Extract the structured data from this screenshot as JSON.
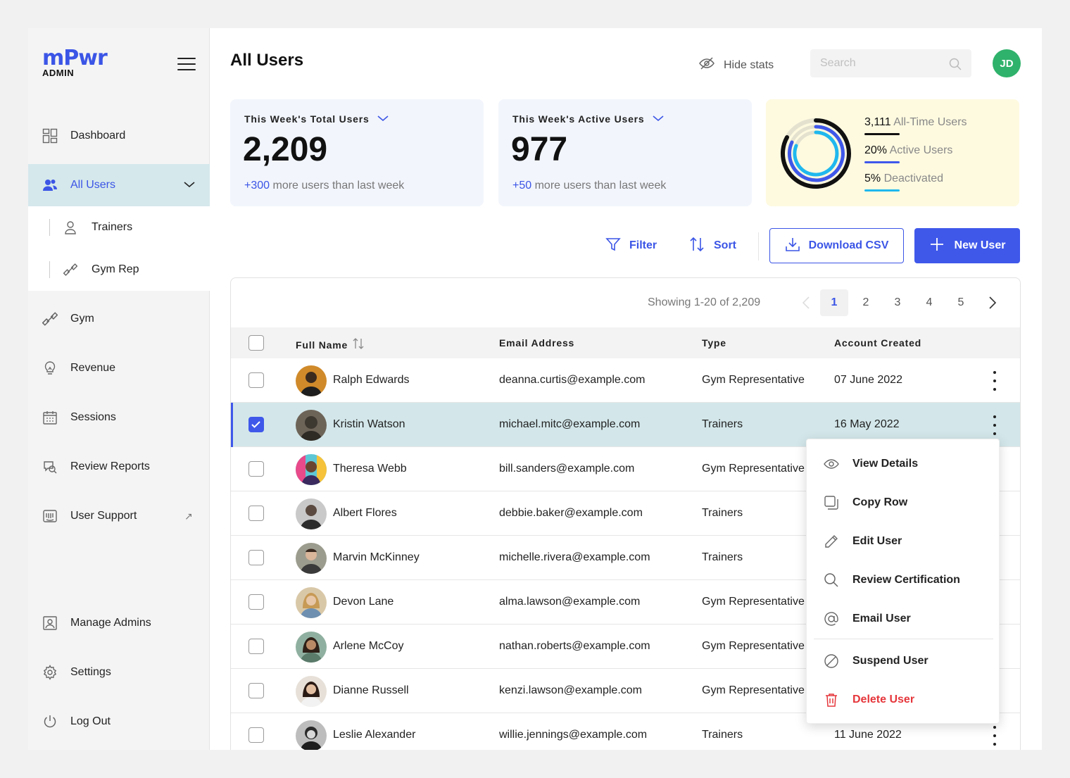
{
  "app": {
    "logo": "mPwr",
    "logo_sub": "ADMIN"
  },
  "sidebar": {
    "items": [
      {
        "label": "Dashboard",
        "icon": "dashboard-icon"
      },
      {
        "label": "All Users",
        "icon": "users-icon"
      },
      {
        "label": "Gym",
        "icon": "dumbbell-icon"
      },
      {
        "label": "Revenue",
        "icon": "lightbulb-icon"
      },
      {
        "label": "Sessions",
        "icon": "calendar-icon"
      },
      {
        "label": "Review Reports",
        "icon": "chat-search-icon"
      },
      {
        "label": "User Support",
        "icon": "keyboard-icon",
        "external": "↗"
      },
      {
        "label": "Manage Admins",
        "icon": "admin-id-icon"
      },
      {
        "label": "Settings",
        "icon": "gear-icon"
      },
      {
        "label": "Log Out",
        "icon": "power-icon"
      }
    ],
    "subitems": [
      {
        "label": "Trainers",
        "icon": "person-icon"
      },
      {
        "label": "Gym Rep",
        "icon": "dumbbell-icon"
      }
    ]
  },
  "header": {
    "title": "All Users",
    "hide_stats": "Hide stats",
    "search_placeholder": "Search",
    "avatar_initials": "JD"
  },
  "stats": {
    "total": {
      "title": "This Week's Total Users",
      "value": "2,209",
      "delta": "+300",
      "delta_text": "more users than last week"
    },
    "active": {
      "title": "This Week's Active Users",
      "value": "977",
      "delta": "+50",
      "delta_text": "more users than last week"
    },
    "summary": [
      {
        "value": "3,111",
        "label": "All-Time Users",
        "color": "#111111"
      },
      {
        "value": "20%",
        "label": "Active Users",
        "color": "#3f58ea"
      },
      {
        "value": "5%",
        "label": "Deactivated",
        "color": "#1fb8ee"
      }
    ]
  },
  "toolbar": {
    "filter": "Filter",
    "sort": "Sort",
    "download": "Download CSV",
    "new_user": "New User"
  },
  "pagination": {
    "showing": "Showing 1-20 of 2,209",
    "pages": [
      "1",
      "2",
      "3",
      "4",
      "5"
    ],
    "current": "1"
  },
  "table": {
    "headers": [
      "Full Name",
      "Email Address",
      "Type",
      "Account Created"
    ],
    "rows": [
      {
        "name": "Ralph Edwards",
        "email": "deanna.curtis@example.com",
        "type": "Gym Representative",
        "created": "07 June 2022"
      },
      {
        "name": "Kristin Watson",
        "email": "michael.mitc@example.com",
        "type": "Trainers",
        "created": "16 May 2022"
      },
      {
        "name": "Theresa Webb",
        "email": "bill.sanders@example.com",
        "type": "Gym Representative",
        "created": ""
      },
      {
        "name": "Albert Flores",
        "email": "debbie.baker@example.com",
        "type": "Trainers",
        "created": ""
      },
      {
        "name": "Marvin McKinney",
        "email": "michelle.rivera@example.com",
        "type": "Trainers",
        "created": ""
      },
      {
        "name": "Devon Lane",
        "email": "alma.lawson@example.com",
        "type": "Gym Representative",
        "created": ""
      },
      {
        "name": "Arlene McCoy",
        "email": "nathan.roberts@example.com",
        "type": "Gym Representative",
        "created": ""
      },
      {
        "name": "Dianne Russell",
        "email": "kenzi.lawson@example.com",
        "type": "Gym Representative",
        "created": ""
      },
      {
        "name": "Leslie Alexander",
        "email": "willie.jennings@example.com",
        "type": "Trainers",
        "created": "11 June 2022"
      }
    ]
  },
  "context_menu": {
    "items": [
      {
        "label": "View Details",
        "icon": "eye-icon"
      },
      {
        "label": "Copy Row",
        "icon": "copy-icon"
      },
      {
        "label": "Edit User",
        "icon": "pencil-icon"
      },
      {
        "label": "Review Certification",
        "icon": "search-icon"
      },
      {
        "label": "Email User",
        "icon": "at-sign-icon"
      },
      {
        "label": "Suspend User",
        "icon": "ban-icon"
      },
      {
        "label": "Delete User",
        "icon": "trash-icon",
        "danger": true
      }
    ]
  },
  "colors": {
    "accent": "#3f58ea",
    "selected_row": "#d3e7ea",
    "danger": "#e5363b",
    "avatar": "#2fb26b"
  }
}
